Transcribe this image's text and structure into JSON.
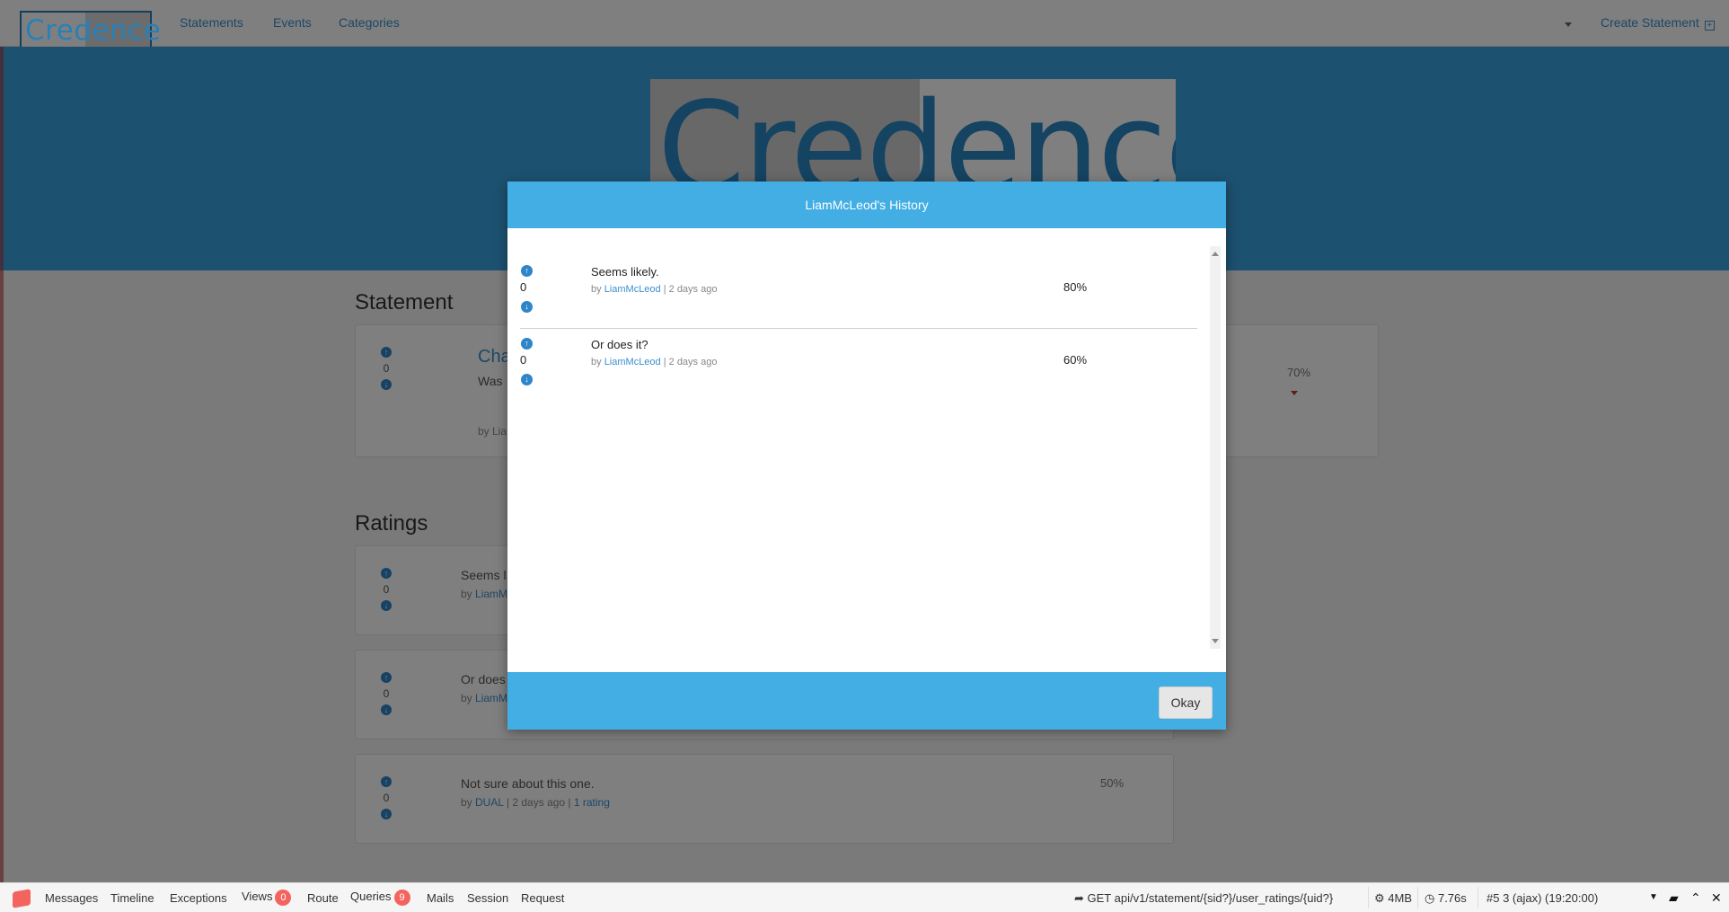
{
  "navbar": {
    "brand": "Credence",
    "links": [
      "Statements",
      "Events",
      "Categories"
    ],
    "create_label": "Create Statement",
    "create_icon": "plus-square-icon"
  },
  "hero": {
    "logo_text": "Credence"
  },
  "statement_section": {
    "title": "Statement",
    "card": {
      "votes": "0",
      "title_partial": "Cha",
      "text_partial": "Was",
      "meta_partial": "by Lia",
      "percent": "70%"
    }
  },
  "ratings_section": {
    "title": "Ratings",
    "items": [
      {
        "votes": "0",
        "text": "Seems l",
        "by_label": "by ",
        "user": "LiamM",
        "meta_rest": "",
        "percent": ""
      },
      {
        "votes": "0",
        "text": "Or does",
        "by_label": "by ",
        "user": "LiamM",
        "meta_rest": "",
        "percent": ""
      },
      {
        "votes": "0",
        "text": "Not sure about this one.",
        "by_label": "by ",
        "user": "DUAL",
        "meta_rest": " | 2 days ago | ",
        "extra_link": "1 rating",
        "percent": "50%"
      }
    ]
  },
  "modal": {
    "title": "LiamMcLeod's History",
    "rows": [
      {
        "votes": "0",
        "text": "Seems likely.",
        "by_label": "by ",
        "user": "LiamMcLeod",
        "time": " | 2 days ago",
        "percent": "80%"
      },
      {
        "votes": "0",
        "text": "Or does it?",
        "by_label": "by ",
        "user": "LiamMcLeod",
        "time": " | 2 days ago",
        "percent": "60%"
      }
    ],
    "okay_label": "Okay"
  },
  "debugbar": {
    "tabs": [
      {
        "label": "Messages"
      },
      {
        "label": "Timeline"
      },
      {
        "label": "Exceptions"
      },
      {
        "label": "Views",
        "badge": "0"
      },
      {
        "label": "Route"
      },
      {
        "label": "Queries",
        "badge": "9"
      },
      {
        "label": "Mails"
      },
      {
        "label": "Session"
      },
      {
        "label": "Request"
      }
    ],
    "request": "GET api/v1/statement/{sid?}/user_ratings/{uid?}",
    "memory": "4MB",
    "time": "7.76s",
    "dataset": "#5 3 (ajax) (19:20:00)"
  },
  "colors": {
    "accent": "#42aee3",
    "hero": "#3aa2e0",
    "link": "#3a8fcf",
    "badge": "#f4645f"
  }
}
